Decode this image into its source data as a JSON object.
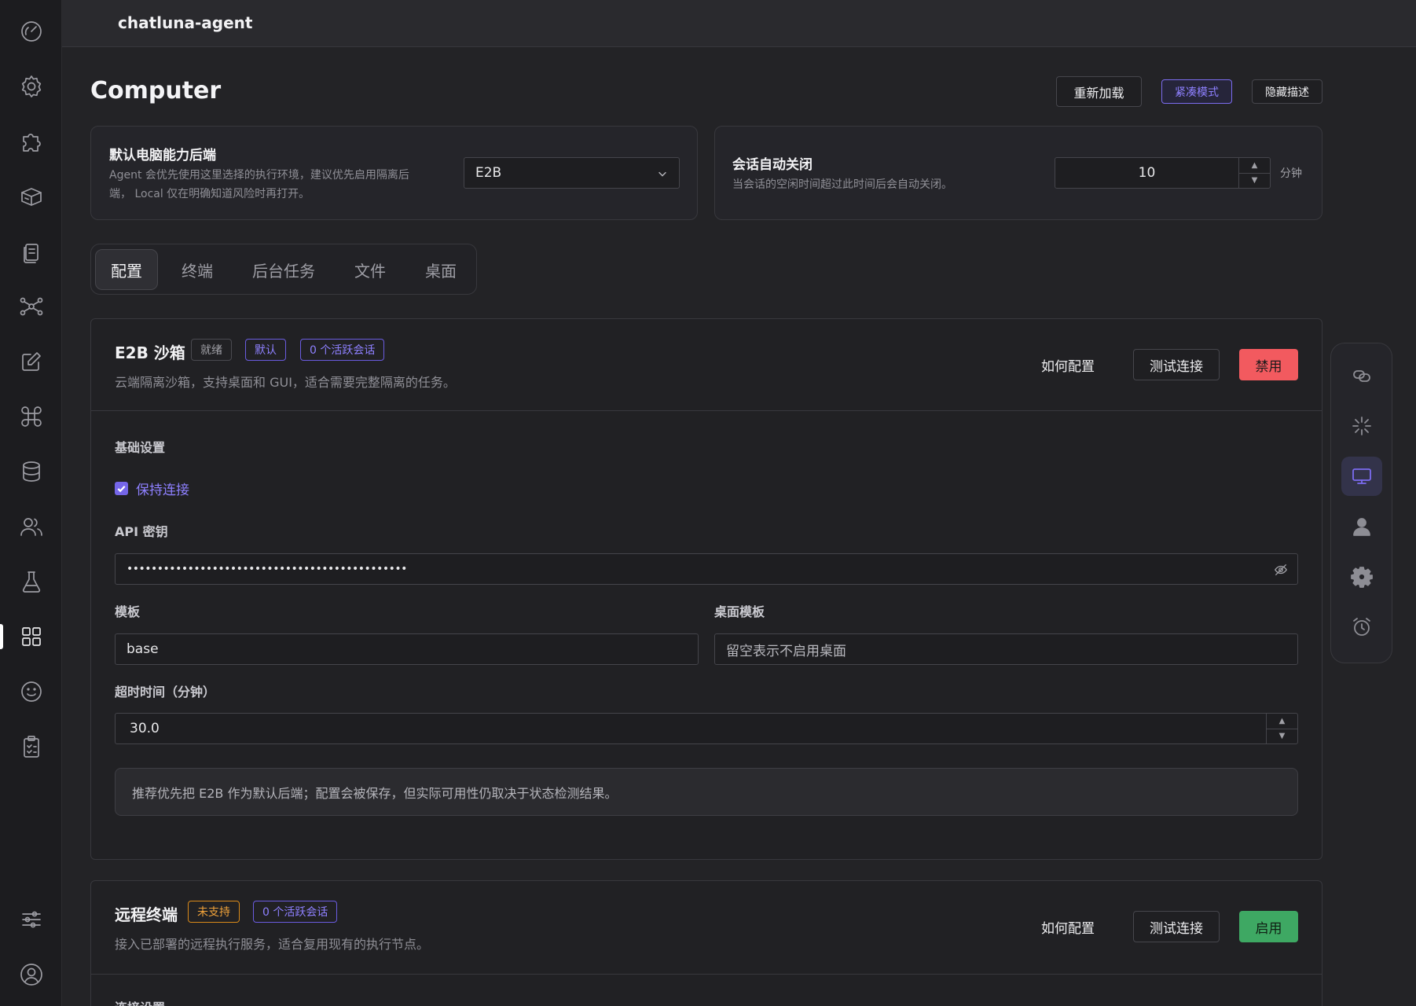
{
  "app": {
    "title": "chatluna-agent"
  },
  "rail": {
    "items": [
      {
        "icon": "dashboard-icon"
      },
      {
        "icon": "gear-icon"
      },
      {
        "icon": "puzzle-icon"
      },
      {
        "icon": "box-icon"
      },
      {
        "icon": "files-icon"
      },
      {
        "icon": "network-icon"
      },
      {
        "icon": "edit-icon"
      },
      {
        "icon": "command-icon"
      },
      {
        "icon": "database-icon"
      },
      {
        "icon": "users-icon"
      },
      {
        "icon": "flask-icon"
      },
      {
        "icon": "apps-icon",
        "active": true
      },
      {
        "icon": "smiley-icon"
      },
      {
        "icon": "clipboard-icon"
      },
      {
        "icon": "sliders-icon"
      },
      {
        "icon": "account-icon"
      }
    ]
  },
  "page": {
    "title": "Computer",
    "actions": {
      "reload": "重新加载",
      "compact": "紧凑模式",
      "hide_desc": "隐藏描述"
    }
  },
  "backend_card": {
    "title": "默认电脑能力后端",
    "desc_line1": "Agent 会优先使用这里选择的执行环境，建议优先启用隔离后",
    "desc_line2": "端， Local 仅在明确知道风险时再打开。",
    "selected": "E2B"
  },
  "session_card": {
    "title": "会话自动关闭",
    "desc": "当会话的空闲时间超过此时间后会自动关闭。",
    "value": "10",
    "unit": "分钟"
  },
  "tabs": [
    {
      "label": "配置",
      "active": true
    },
    {
      "label": "终端"
    },
    {
      "label": "后台任务"
    },
    {
      "label": "文件"
    },
    {
      "label": "桌面"
    }
  ],
  "e2b": {
    "title": "E2B 沙箱",
    "tags": {
      "status": "就绪",
      "default": "默认",
      "sessions": "0 个活跃会话"
    },
    "desc": "云端隔离沙箱，支持桌面和 GUI，适合需要完整隔离的任务。",
    "actions": {
      "howto": "如何配置",
      "test": "测试连接",
      "toggle": "禁用"
    },
    "basic_heading": "基础设置",
    "keep_alive_label": "保持连接",
    "keep_alive": true,
    "api_key_label": "API 密钥",
    "api_key_value": "••••••••••••••••••••••••••••••••••••••••••••••",
    "template_label": "模板",
    "template_value": "base",
    "desktop_template_label": "桌面模板",
    "desktop_template_placeholder": "留空表示不启用桌面",
    "timeout_label": "超时时间（分钟）",
    "timeout_value": "30.0",
    "note": "推荐优先把 E2B 作为默认后端；配置会被保存，但实际可用性仍取决于状态检测结果。"
  },
  "remote": {
    "title": "远程终端",
    "tags": {
      "status": "未支持",
      "sessions": "0 个活跃会话"
    },
    "desc": "接入已部署的远程执行服务，适合复用现有的执行节点。",
    "actions": {
      "howto": "如何配置",
      "test": "测试连接",
      "toggle": "启用"
    },
    "next_heading": "连接设置"
  },
  "dock": {
    "items": [
      {
        "icon": "link-icon"
      },
      {
        "icon": "sparkle-icon"
      },
      {
        "icon": "monitor-icon",
        "active": true
      },
      {
        "icon": "person-icon"
      },
      {
        "icon": "cog-icon"
      },
      {
        "icon": "alarm-clock-icon"
      }
    ]
  }
}
